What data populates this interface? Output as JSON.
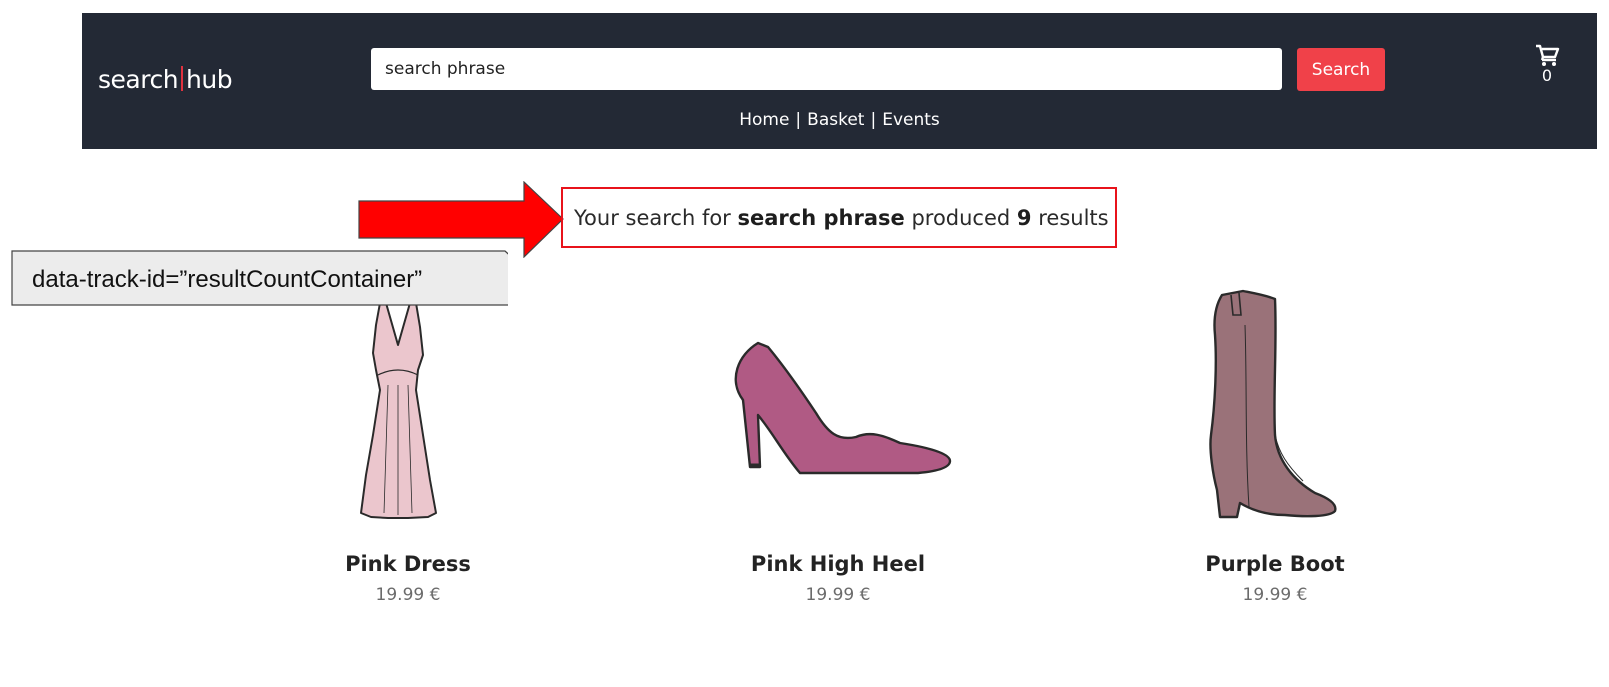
{
  "header": {
    "logo_left": "search",
    "logo_right": "hub",
    "search_value": "search phrase",
    "search_button_label": "Search",
    "nav": [
      "Home",
      "Basket",
      "Events"
    ],
    "nav_separator": "|",
    "cart_count": "0"
  },
  "result_count": {
    "prefix": "Your search for",
    "query": "search phrase",
    "middle": "produced",
    "count": "9",
    "suffix": "results"
  },
  "annotation": {
    "label": "data-track-id=”resultCountContainer”"
  },
  "products": [
    {
      "name": "Pink Dress",
      "price": "19.99 €"
    },
    {
      "name": "Pink High Heel",
      "price": "19.99 €"
    },
    {
      "name": "Purple Boot",
      "price": "19.99 €"
    }
  ],
  "colors": {
    "header_bg": "#232935",
    "accent": "#f04149",
    "annotation_red": "#ff0000"
  }
}
